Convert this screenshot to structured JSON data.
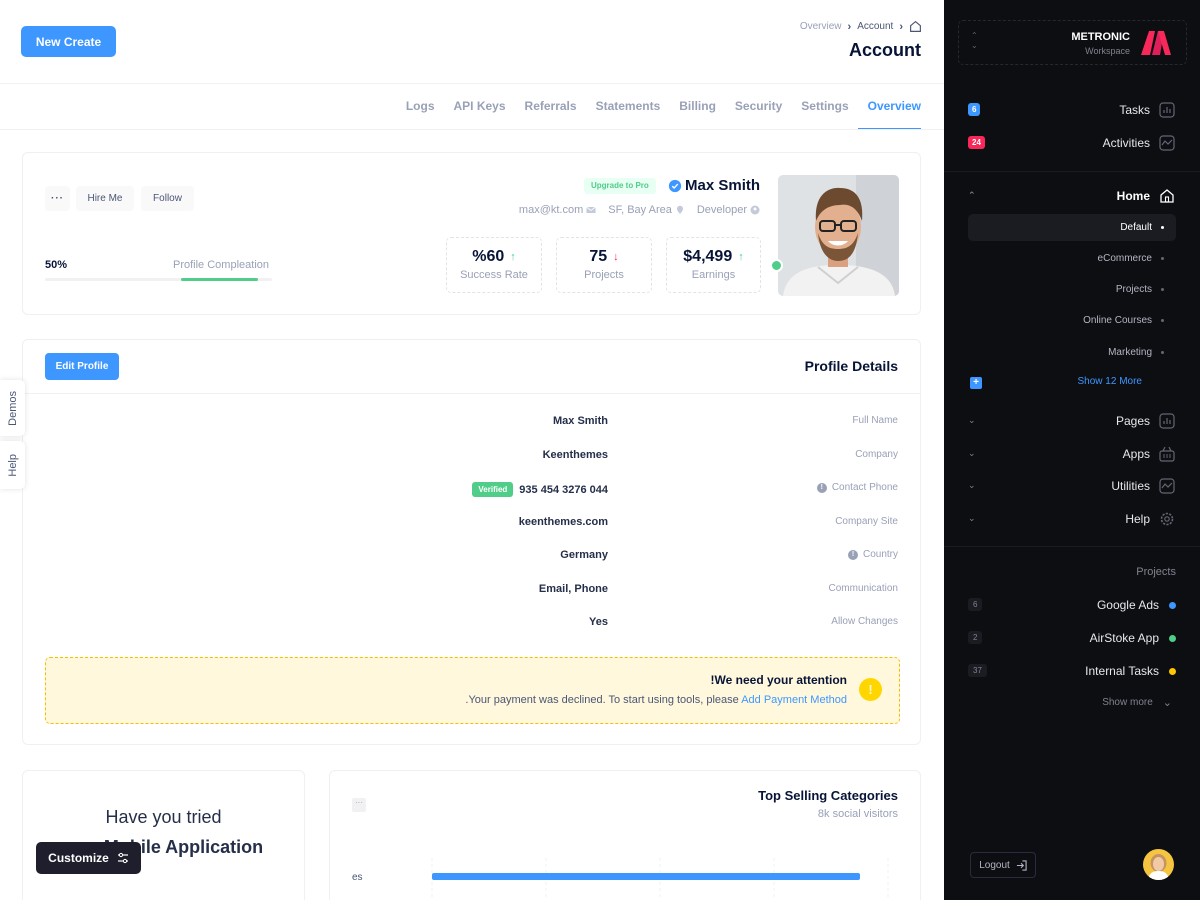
{
  "header": {
    "new_create": "New  Create",
    "breadcrumb": [
      "Overview",
      "Account"
    ],
    "title": "Account"
  },
  "tabs": [
    "Logs",
    "API Keys",
    "Referrals",
    "Statements",
    "Billing",
    "Security",
    "Settings",
    "Overview"
  ],
  "active_tab": "Overview",
  "profile": {
    "dots": "···",
    "hire_me": "Hire Me",
    "follow": "Follow",
    "progress_pct": "50%",
    "progress_value": 0.5,
    "progress_label": "Profile Compleation",
    "upgrade": "Upgrade to Pro",
    "name": "Max Smith",
    "email": "max@kt.com",
    "location": "SF, Bay Area",
    "role": "Developer",
    "stats": [
      {
        "value": "%60",
        "label": "Success Rate",
        "trend": "up"
      },
      {
        "value": "75",
        "label": "Projects",
        "trend": "down"
      },
      {
        "value": "$4,499",
        "label": "Earnings",
        "trend": "up"
      }
    ]
  },
  "details": {
    "edit": "Edit Profile",
    "title": "Profile Details",
    "rows": [
      {
        "value": "Max Smith",
        "label": "Full Name",
        "info": false,
        "badge": ""
      },
      {
        "value": "Keenthemes",
        "label": "Company",
        "info": false,
        "badge": ""
      },
      {
        "value": "935 454 3276 044",
        "label": "Contact Phone",
        "info": true,
        "badge": "Verified"
      },
      {
        "value": "keenthemes.com",
        "label": "Company Site",
        "info": false,
        "badge": ""
      },
      {
        "value": "Germany",
        "label": "Country",
        "info": true,
        "badge": ""
      },
      {
        "value": "Email, Phone",
        "label": "Communication",
        "info": false,
        "badge": ""
      },
      {
        "value": "Yes",
        "label": "Allow Changes",
        "info": false,
        "badge": ""
      }
    ],
    "alert_title": "!We need your attention",
    "alert_text": ".Your payment was declined. To start using tools, please ",
    "alert_link": "Add Payment Method",
    "alert_icon": "!"
  },
  "app_card": {
    "line1": "Have you tried",
    "line2": "new Mobile Application"
  },
  "categories": {
    "title": "Top Selling Categories",
    "subtitle": "8k social visitors",
    "bar_label": "es",
    "menu": "···"
  },
  "side_tabs": {
    "demos": "Demos",
    "help": "Help"
  },
  "customize": "Customize",
  "sidebar": {
    "brand": "METRONIC",
    "workspace": "Workspace",
    "tasks": {
      "label": "Tasks",
      "count": "6",
      "color": "#3e97ff"
    },
    "activities": {
      "label": "Activities",
      "count": "24",
      "color": "#f8285a"
    },
    "home": "Home",
    "home_items": [
      "Default",
      "eCommerce",
      "Projects",
      "Online Courses",
      "Marketing"
    ],
    "show_more": "Show 12 More",
    "sections": [
      "Pages",
      "Apps",
      "Utilities",
      "Help"
    ],
    "projects_title": "Projects",
    "projects": [
      {
        "name": "Google Ads",
        "count": "6",
        "color": "#3e97ff"
      },
      {
        "name": "AirStoke App",
        "count": "2",
        "color": "#50cd89"
      },
      {
        "name": "Internal Tasks",
        "count": "37",
        "color": "#ffc700"
      }
    ],
    "show_more2": "Show more",
    "logout": "Logout"
  },
  "colors": {
    "primary": "#3e97ff",
    "success": "#50cd89",
    "danger": "#f8285a",
    "warning": "#ffc700",
    "sidebar_bg": "#0d0e12"
  }
}
